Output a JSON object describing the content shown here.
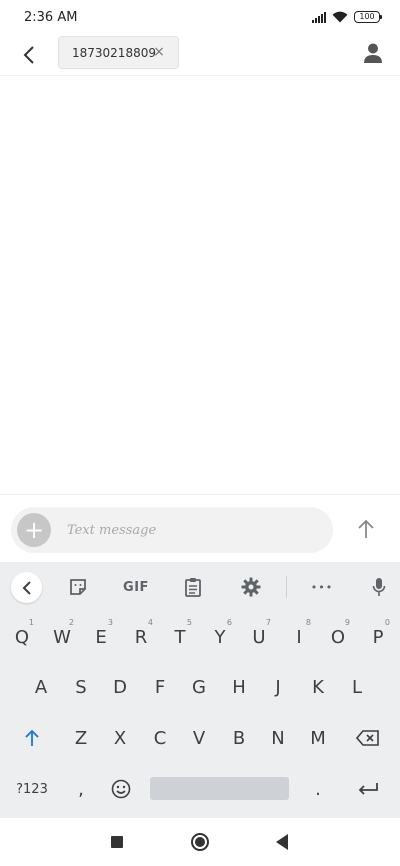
{
  "status_bar": {
    "time": "2:36 AM",
    "battery": "100"
  },
  "header": {
    "recipient": "18730218809",
    "chip_close_glyph": "×",
    "icons": {
      "back": "chevron-left-icon",
      "contact": "person-icon"
    }
  },
  "compose": {
    "placeholder": "Text message",
    "attach_glyph": "+",
    "icons": {
      "attach": "plus-icon",
      "send": "arrow-up-icon"
    }
  },
  "keyboard": {
    "toolbar": {
      "gif_label": "GIF",
      "more_glyph": "•••"
    },
    "row1": [
      {
        "label": "Q",
        "hint": "1"
      },
      {
        "label": "W",
        "hint": "2"
      },
      {
        "label": "E",
        "hint": "3"
      },
      {
        "label": "R",
        "hint": "4"
      },
      {
        "label": "T",
        "hint": "5"
      },
      {
        "label": "Y",
        "hint": "6"
      },
      {
        "label": "U",
        "hint": "7"
      },
      {
        "label": "I",
        "hint": "8"
      },
      {
        "label": "O",
        "hint": "9"
      },
      {
        "label": "P",
        "hint": "0"
      }
    ],
    "row2": [
      "A",
      "S",
      "D",
      "F",
      "G",
      "H",
      "J",
      "K",
      "L"
    ],
    "row3": [
      "Z",
      "X",
      "C",
      "V",
      "B",
      "N",
      "M"
    ],
    "row4": {
      "symbols": "?123",
      "comma": ",",
      "period": "."
    },
    "accent_color": "#1a73e8"
  },
  "colors": {
    "keyboard_bg": "#eceef0",
    "key_text": "#3c4043",
    "shift_blue": "#1a73e8"
  }
}
